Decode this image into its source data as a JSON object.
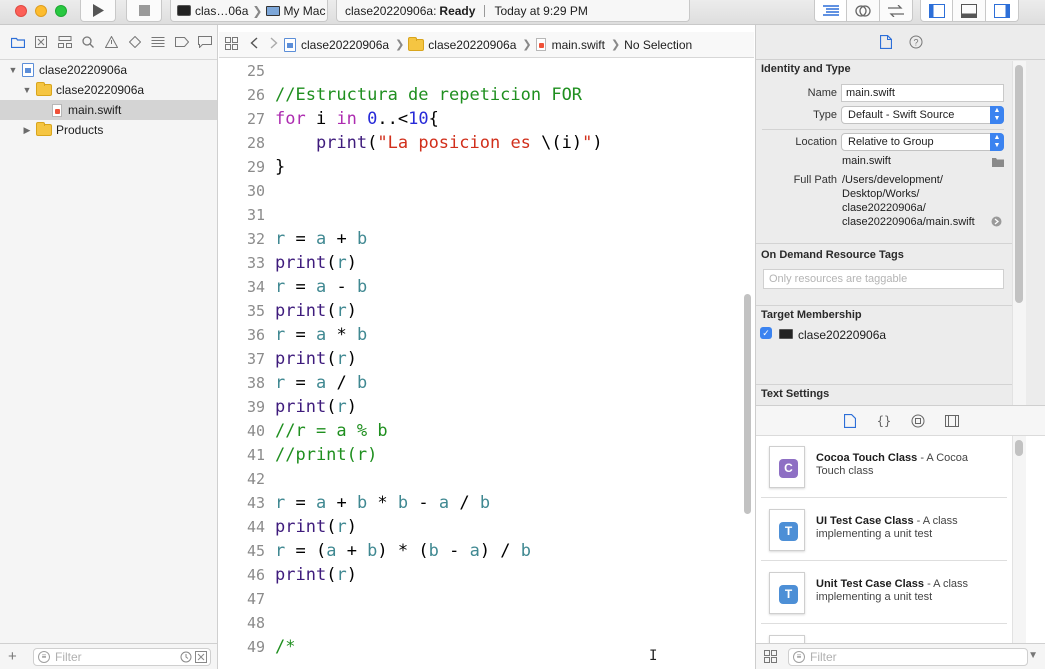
{
  "toolbar": {
    "scheme_target": "clas…06a",
    "scheme_destination": "My Mac",
    "activity_project": "clase20220906a:",
    "activity_status": "Ready",
    "activity_time": "Today at 9:29 PM"
  },
  "navigator": {
    "tree": [
      {
        "label": "clase20220906a",
        "kind": "project",
        "expanded": true
      },
      {
        "label": "clase20220906a",
        "kind": "folder",
        "expanded": true
      },
      {
        "label": "main.swift",
        "kind": "swift-file",
        "selected": true
      },
      {
        "label": "Products",
        "kind": "folder",
        "expanded": false
      }
    ],
    "filter_placeholder": "Filter"
  },
  "jumpbar": {
    "crumbs": [
      "clase20220906a",
      "clase20220906a",
      "main.swift",
      "No Selection"
    ]
  },
  "editor": {
    "lines": [
      {
        "n": "25",
        "segs": []
      },
      {
        "n": "26",
        "segs": [
          {
            "c": "cm",
            "t": "//Estructura de repeticion FOR"
          }
        ]
      },
      {
        "n": "27",
        "segs": [
          {
            "c": "kw",
            "t": "for"
          },
          {
            "c": "",
            "t": " i "
          },
          {
            "c": "kw",
            "t": "in"
          },
          {
            "c": "",
            "t": " "
          },
          {
            "c": "num",
            "t": "0"
          },
          {
            "c": "",
            "t": "..<"
          },
          {
            "c": "num",
            "t": "10"
          },
          {
            "c": "",
            "t": "{"
          }
        ]
      },
      {
        "n": "28",
        "segs": [
          {
            "c": "",
            "t": "    "
          },
          {
            "c": "fn",
            "t": "print"
          },
          {
            "c": "",
            "t": "("
          },
          {
            "c": "str",
            "t": "\"La posicion es "
          },
          {
            "c": "",
            "t": "\\(i)"
          },
          {
            "c": "str",
            "t": "\""
          },
          {
            "c": "",
            "t": ")"
          }
        ]
      },
      {
        "n": "29",
        "segs": [
          {
            "c": "",
            "t": "}"
          }
        ]
      },
      {
        "n": "30",
        "segs": []
      },
      {
        "n": "31",
        "segs": []
      },
      {
        "n": "32",
        "segs": [
          {
            "c": "var",
            "t": "r"
          },
          {
            "c": "",
            "t": " = "
          },
          {
            "c": "var",
            "t": "a"
          },
          {
            "c": "",
            "t": " + "
          },
          {
            "c": "var",
            "t": "b"
          }
        ]
      },
      {
        "n": "33",
        "segs": [
          {
            "c": "fn",
            "t": "print"
          },
          {
            "c": "",
            "t": "("
          },
          {
            "c": "var",
            "t": "r"
          },
          {
            "c": "",
            "t": ")"
          }
        ]
      },
      {
        "n": "34",
        "segs": [
          {
            "c": "var",
            "t": "r"
          },
          {
            "c": "",
            "t": " = "
          },
          {
            "c": "var",
            "t": "a"
          },
          {
            "c": "",
            "t": " - "
          },
          {
            "c": "var",
            "t": "b"
          }
        ]
      },
      {
        "n": "35",
        "segs": [
          {
            "c": "fn",
            "t": "print"
          },
          {
            "c": "",
            "t": "("
          },
          {
            "c": "var",
            "t": "r"
          },
          {
            "c": "",
            "t": ")"
          }
        ]
      },
      {
        "n": "36",
        "segs": [
          {
            "c": "var",
            "t": "r"
          },
          {
            "c": "",
            "t": " = "
          },
          {
            "c": "var",
            "t": "a"
          },
          {
            "c": "",
            "t": " * "
          },
          {
            "c": "var",
            "t": "b"
          }
        ]
      },
      {
        "n": "37",
        "segs": [
          {
            "c": "fn",
            "t": "print"
          },
          {
            "c": "",
            "t": "("
          },
          {
            "c": "var",
            "t": "r"
          },
          {
            "c": "",
            "t": ")"
          }
        ]
      },
      {
        "n": "38",
        "segs": [
          {
            "c": "var",
            "t": "r"
          },
          {
            "c": "",
            "t": " = "
          },
          {
            "c": "var",
            "t": "a"
          },
          {
            "c": "",
            "t": " / "
          },
          {
            "c": "var",
            "t": "b"
          }
        ]
      },
      {
        "n": "39",
        "segs": [
          {
            "c": "fn",
            "t": "print"
          },
          {
            "c": "",
            "t": "("
          },
          {
            "c": "var",
            "t": "r"
          },
          {
            "c": "",
            "t": ")"
          }
        ]
      },
      {
        "n": "40",
        "segs": [
          {
            "c": "cm",
            "t": "//r = a % b"
          }
        ]
      },
      {
        "n": "41",
        "segs": [
          {
            "c": "cm",
            "t": "//print(r)"
          }
        ]
      },
      {
        "n": "42",
        "segs": []
      },
      {
        "n": "43",
        "segs": [
          {
            "c": "var",
            "t": "r"
          },
          {
            "c": "",
            "t": " = "
          },
          {
            "c": "var",
            "t": "a"
          },
          {
            "c": "",
            "t": " + "
          },
          {
            "c": "var",
            "t": "b"
          },
          {
            "c": "",
            "t": " * "
          },
          {
            "c": "var",
            "t": "b"
          },
          {
            "c": "",
            "t": " - "
          },
          {
            "c": "var",
            "t": "a"
          },
          {
            "c": "",
            "t": " / "
          },
          {
            "c": "var",
            "t": "b"
          }
        ]
      },
      {
        "n": "44",
        "segs": [
          {
            "c": "fn",
            "t": "print"
          },
          {
            "c": "",
            "t": "("
          },
          {
            "c": "var",
            "t": "r"
          },
          {
            "c": "",
            "t": ")"
          }
        ]
      },
      {
        "n": "45",
        "segs": [
          {
            "c": "var",
            "t": "r"
          },
          {
            "c": "",
            "t": " = ("
          },
          {
            "c": "var",
            "t": "a"
          },
          {
            "c": "",
            "t": " + "
          },
          {
            "c": "var",
            "t": "b"
          },
          {
            "c": "",
            "t": ") * ("
          },
          {
            "c": "var",
            "t": "b"
          },
          {
            "c": "",
            "t": " - "
          },
          {
            "c": "var",
            "t": "a"
          },
          {
            "c": "",
            "t": ") / "
          },
          {
            "c": "var",
            "t": "b"
          }
        ]
      },
      {
        "n": "46",
        "segs": [
          {
            "c": "fn",
            "t": "print"
          },
          {
            "c": "",
            "t": "("
          },
          {
            "c": "var",
            "t": "r"
          },
          {
            "c": "",
            "t": ")"
          }
        ]
      },
      {
        "n": "47",
        "segs": []
      },
      {
        "n": "48",
        "segs": []
      },
      {
        "n": "49",
        "segs": [
          {
            "c": "cm",
            "t": "/*"
          }
        ]
      }
    ]
  },
  "inspector": {
    "identity_title": "Identity and Type",
    "name_label": "Name",
    "name_value": "main.swift",
    "type_label": "Type",
    "type_value": "Default - Swift Source",
    "location_label": "Location",
    "location_value": "Relative to Group",
    "location_file": "main.swift",
    "fullpath_label": "Full Path",
    "fullpath_lines": [
      "/Users/development/",
      "Desktop/Works/",
      "clase20220906a/",
      "clase20220906a/main.swift"
    ],
    "ondemand_title": "On Demand Resource Tags",
    "ondemand_placeholder": "Only resources are taggable",
    "target_title": "Target Membership",
    "target_name": "clase20220906a",
    "target_checked": true,
    "text_settings_title": "Text Settings",
    "library_items": [
      {
        "title": "Cocoa Touch Class",
        "desc": " - A Cocoa Touch class",
        "badge": "C",
        "color": "#8e6fc4"
      },
      {
        "title": "UI Test Case Class",
        "desc": " - A class implementing a unit test",
        "badge": "T",
        "color": "#4d8fd6"
      },
      {
        "title": "Unit Test Case Class",
        "desc": " - A class implementing a unit test",
        "badge": "T",
        "color": "#4d8fd6"
      }
    ],
    "library_filter_placeholder": "Filter"
  }
}
